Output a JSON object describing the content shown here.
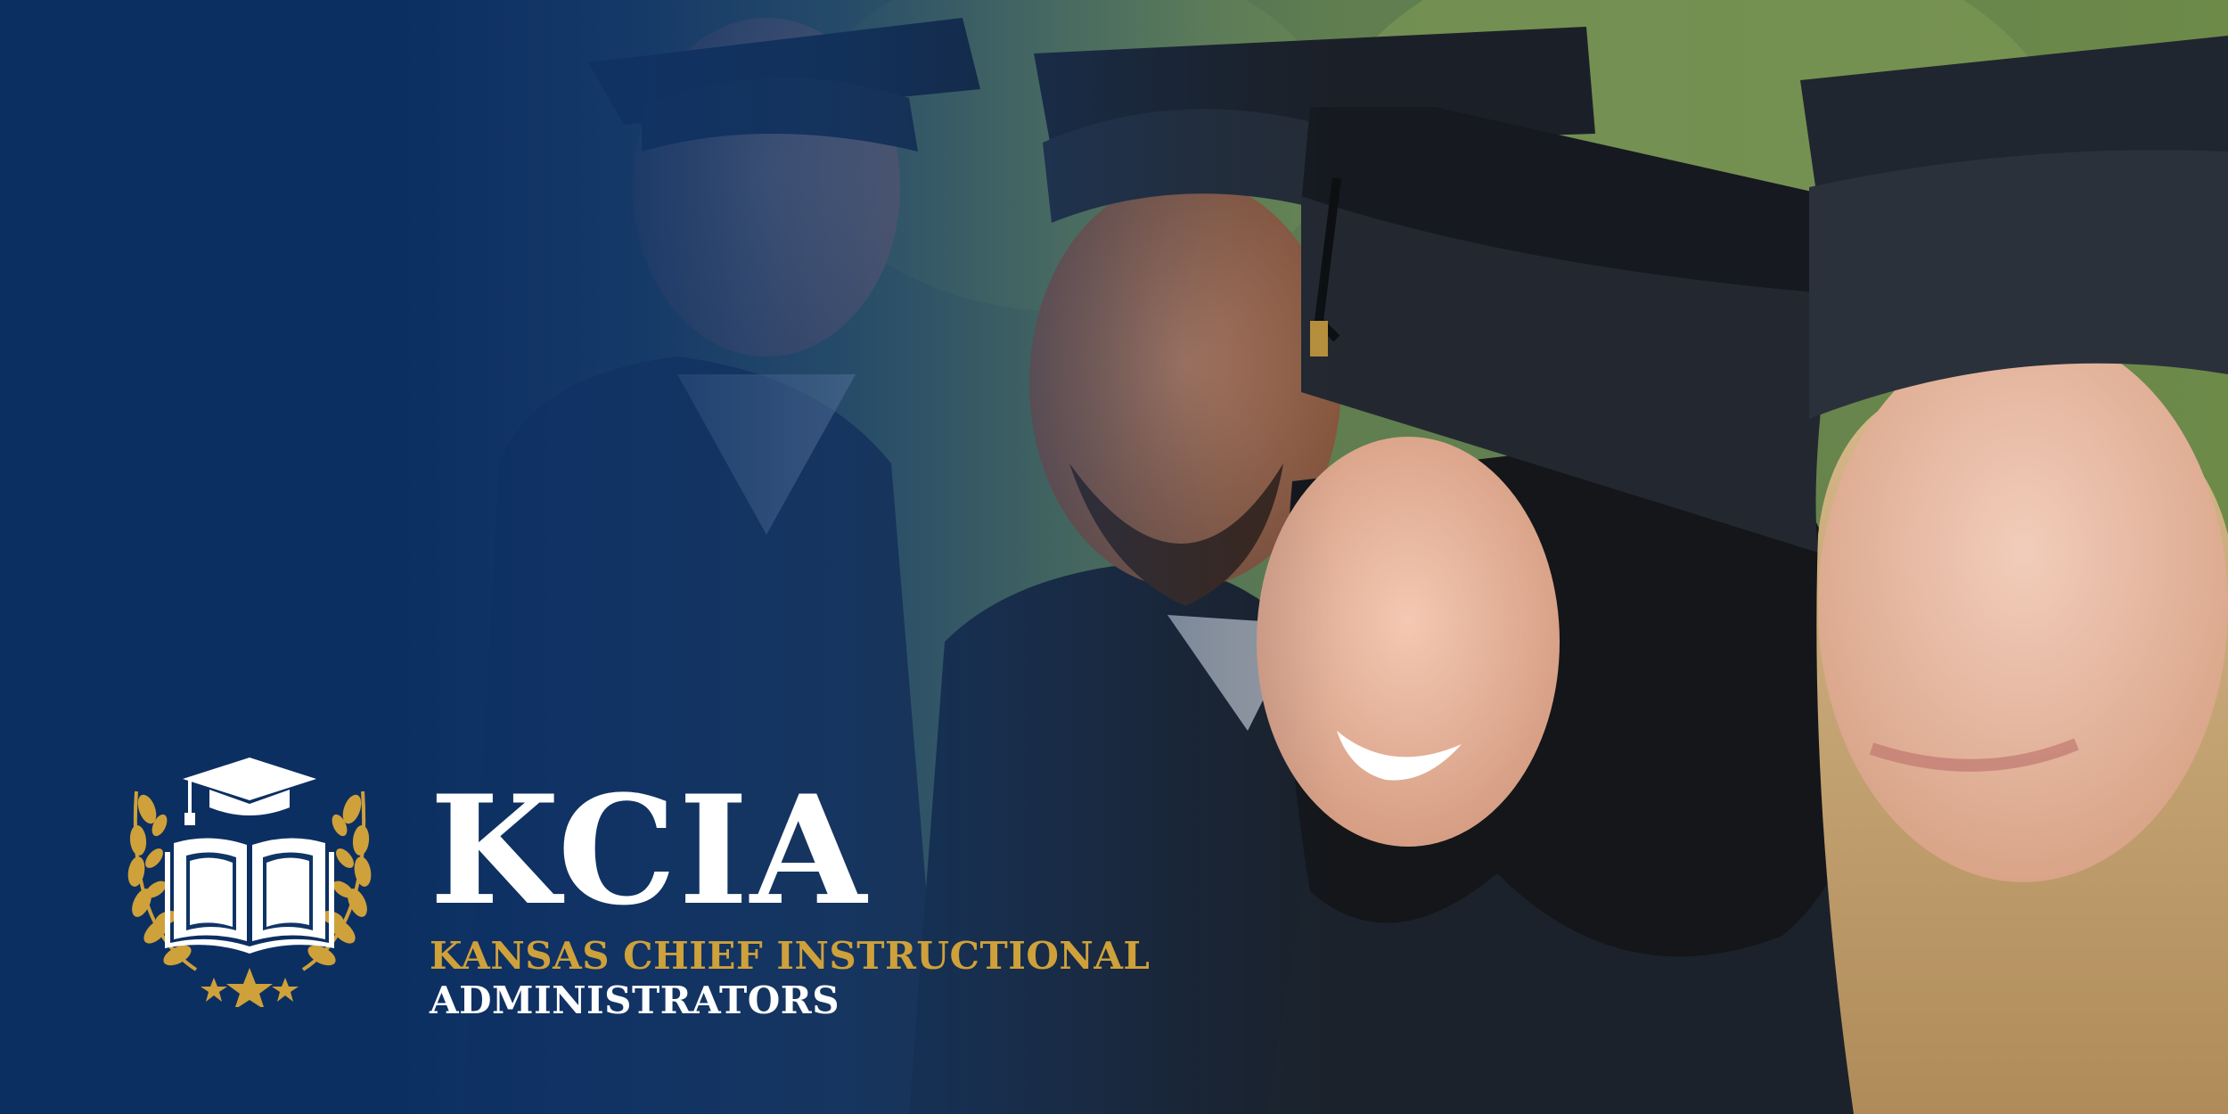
{
  "brand": {
    "acronym": "KCIA",
    "line1": "KANSAS CHIEF INSTRUCTIONAL",
    "line2": "ADMINISTRATORS"
  },
  "colors": {
    "navy": "#0f3566",
    "gold": "#cfa13a",
    "white": "#ffffff"
  },
  "icons": {
    "emblem": "graduation-cap-book-laurel-icon"
  }
}
